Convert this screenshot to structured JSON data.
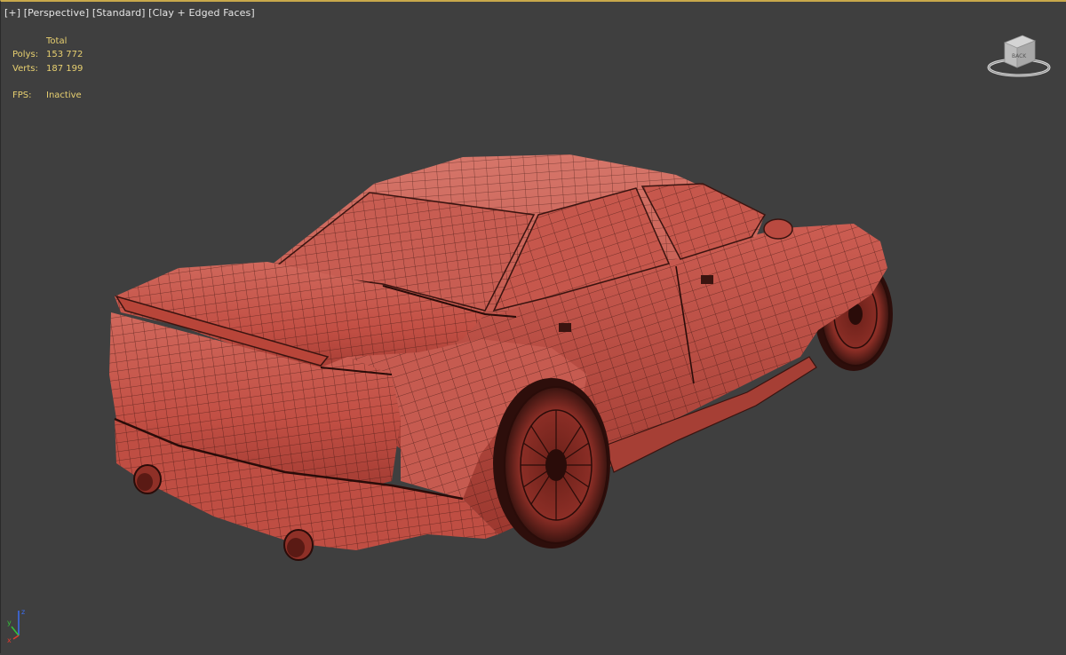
{
  "viewport": {
    "label_parts": [
      "[+]",
      "[Perspective]",
      "[Standard]",
      "[Clay + Edged Faces]"
    ]
  },
  "stats": {
    "header": "Total",
    "polys_label": "Polys:",
    "polys_value": "153 772",
    "verts_label": "Verts:",
    "verts_value": "187 199",
    "fps_label": "FPS:",
    "fps_value": "Inactive"
  },
  "viewcube": {
    "face_label": "BACK"
  },
  "axis": {
    "x": "x",
    "y": "y",
    "z": "z"
  },
  "colors": {
    "background": "#3f3f3f",
    "active_border": "#c8a84b",
    "stats_text": "#e8d070",
    "clay": "#c8564a",
    "edges": "#3a1410"
  },
  "model": {
    "icon": "car-model"
  }
}
